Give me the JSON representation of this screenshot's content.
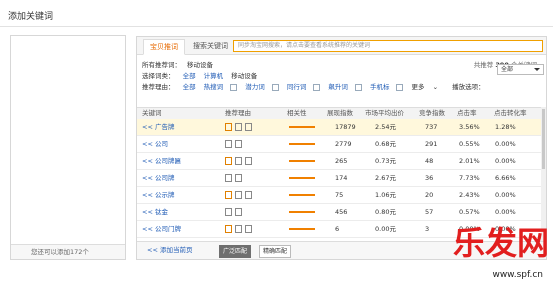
{
  "dialog": {
    "title": "添加关键词"
  },
  "left": {
    "footer": "您还可以添加172个"
  },
  "tabs": {
    "recommend": "宝贝推词",
    "search": "搜索关键词"
  },
  "search": {
    "placeholder": "同步淘宝网搜索，请点击要查看系统推荐的关键词"
  },
  "filters": {
    "path_label": "所有推荐词：",
    "path_value": "移动设备",
    "type_label": "选择词类：",
    "type_all": "全部",
    "type_a": "计算机",
    "type_b": "移动设备",
    "reason_label": "推荐理由：",
    "reason_all": "全部",
    "r1": "热搜词",
    "r2": "潜力词",
    "r3": "同行词",
    "r4": "飙升词",
    "r5": "手机标",
    "more": "更多",
    "sort_label": "播放选项：",
    "sort_value": "全部"
  },
  "count": {
    "prefix": "共推荐",
    "num": "390",
    "suffix": "个关键词"
  },
  "table": {
    "headers": [
      "关键词",
      "推荐理由",
      "相关性",
      "展现指数",
      "市场平均出价",
      "竞争指数",
      "点击率",
      "点击转化率"
    ],
    "rows": [
      {
        "kw": "<< 广告牌",
        "rel": "",
        "shows": "17879",
        "price": "2.54元",
        "comp": "737",
        "ctr": "3.56%",
        "cvr": "1.28%",
        "hl": true
      },
      {
        "kw": "<< 公司",
        "rel": "",
        "shows": "2779",
        "price": "0.68元",
        "comp": "291",
        "ctr": "0.55%",
        "cvr": "0.00%",
        "hl": false
      },
      {
        "kw": "<< 公司牌匾",
        "rel": "",
        "shows": "265",
        "price": "0.73元",
        "comp": "48",
        "ctr": "2.01%",
        "cvr": "0.00%",
        "hl": false
      },
      {
        "kw": "<< 公司牌",
        "rel": "",
        "shows": "174",
        "price": "2.67元",
        "comp": "36",
        "ctr": "7.73%",
        "cvr": "6.66%",
        "hl": false
      },
      {
        "kw": "<< 公示牌",
        "rel": "",
        "shows": "75",
        "price": "1.06元",
        "comp": "20",
        "ctr": "2.43%",
        "cvr": "0.00%",
        "hl": false
      },
      {
        "kw": "<< 钛金",
        "rel": "",
        "shows": "456",
        "price": "0.80元",
        "comp": "57",
        "ctr": "0.57%",
        "cvr": "0.00%",
        "hl": false
      },
      {
        "kw": "<< 公司门牌",
        "rel": "",
        "shows": "6",
        "price": "0.00元",
        "comp": "3",
        "ctr": "0.00%",
        "cvr": "0.00%",
        "hl": false
      }
    ]
  },
  "footer": {
    "add_page": "<< 添加当前页",
    "btn_wide": "广泛匹配",
    "btn_exact": "精确匹配"
  },
  "watermark": {
    "cn": "乐发网",
    "url": "www.spf.cn"
  }
}
